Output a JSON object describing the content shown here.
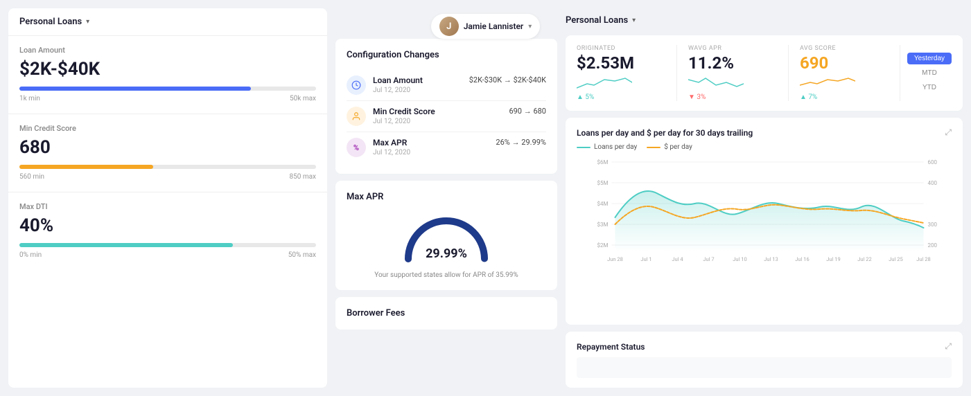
{
  "leftPanel": {
    "header": "Personal Loans",
    "loanAmount": {
      "label": "Loan Amount",
      "value": "$2K-$40K",
      "fillPercent": 78,
      "minLabel": "1k min",
      "maxLabel": "50k max",
      "fillColor": "blue"
    },
    "creditScore": {
      "label": "Min Credit Score",
      "value": "680",
      "fillPercent": 45,
      "minLabel": "560 min",
      "maxLabel": "850 max",
      "fillColor": "orange"
    },
    "maxDTI": {
      "label": "Max DTI",
      "value": "40%",
      "fillPercent": 72,
      "minLabel": "0% min",
      "maxLabel": "50% max",
      "fillColor": "teal"
    }
  },
  "centerPanel": {
    "configChanges": {
      "title": "Configuration Changes",
      "items": [
        {
          "name": "Loan Amount",
          "change": "$2K-$30K → $2K-$40K",
          "date": "Jul 12, 2020",
          "iconType": "blue-bg",
          "icon": "💲"
        },
        {
          "name": "Min Credit Score",
          "change": "690 → 680",
          "date": "Jul 12, 2020",
          "iconType": "orange-bg",
          "icon": "👤"
        },
        {
          "name": "Max APR",
          "change": "26% → 29.99%",
          "date": "Jul 12, 2020",
          "iconType": "purple-bg",
          "icon": "%"
        }
      ]
    },
    "maxAPR": {
      "title": "Max APR",
      "value": "29.99%",
      "note": "Your supported states allow for APR of 35.99%"
    },
    "borrowerFees": {
      "title": "Borrower Fees"
    }
  },
  "rightPanel": {
    "header": "Personal Loans",
    "stats": {
      "originated": {
        "label": "ORIGINATED",
        "value": "$2.53M",
        "change": "▲ 5%",
        "changeType": "up"
      },
      "wavgAPR": {
        "label": "WAVG APR",
        "value": "11.2%",
        "change": "▼ 3%",
        "changeType": "down"
      },
      "avgScore": {
        "label": "AVG SCORE",
        "value": "690",
        "change": "▲ 7%",
        "changeType": "up"
      }
    },
    "timeButtons": [
      "Yesterday",
      "MTD",
      "YTD"
    ],
    "activeTimeButton": "Yesterday",
    "chart": {
      "title": "Loans per day and $ per day for 30 days trailing",
      "legend": [
        {
          "label": "Loans per day",
          "color": "teal"
        },
        {
          "label": "$ per day",
          "color": "yellow"
        }
      ],
      "xLabels": [
        "Jun 28",
        "Jul 1",
        "Jul 4",
        "Jul 7",
        "Jul 10",
        "Jul 13",
        "Jul 16",
        "Jul 19",
        "Jul 22",
        "Jul 25",
        "Jul 28"
      ],
      "yLabelsLeft": [
        "$6M",
        "$5M",
        "$4M",
        "$3M",
        "$2M"
      ],
      "yLabelsRight": [
        "600",
        "400",
        "300",
        "200"
      ]
    },
    "repayment": {
      "title": "Repayment Status"
    }
  },
  "topHeader": {
    "userName": "Jamie Lannister",
    "chevron": "▾"
  }
}
